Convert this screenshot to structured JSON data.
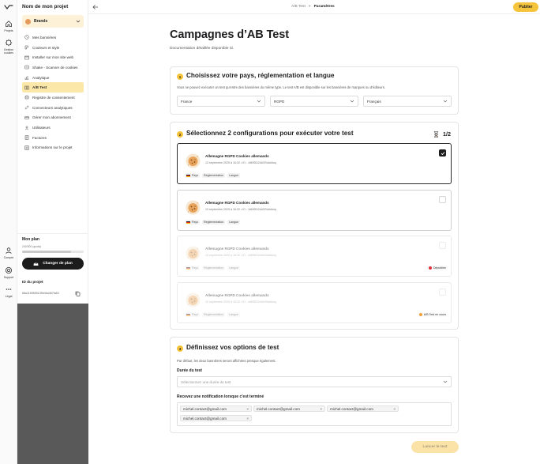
{
  "rail": {
    "items": [
      {
        "label": "Projets"
      },
      {
        "label": "Gestion cookies"
      },
      {
        "label": "Compte"
      },
      {
        "label": "Support"
      },
      {
        "label": "Légal"
      }
    ]
  },
  "sidebar": {
    "project_name": "Nom de mon projet",
    "brand_select": "Brands",
    "items": [
      {
        "label": "Mes bannières",
        "icon": "banner-icon"
      },
      {
        "label": "Couleurs et style",
        "icon": "palette-icon"
      },
      {
        "label": "Installer sur mon site web",
        "icon": "code-icon"
      },
      {
        "label": "Shake - Scanner de cookies",
        "icon": "scanner-icon"
      },
      {
        "label": "Analytique",
        "icon": "analytics-icon"
      },
      {
        "label": "A/B Test",
        "icon": "ab-test-icon",
        "active": true
      },
      {
        "label": "Registre de consentement",
        "icon": "registry-icon"
      },
      {
        "label": "Connecteurs analytiques",
        "icon": "link-icon"
      },
      {
        "label": "Gérer mon abonnement",
        "icon": "subscription-icon"
      },
      {
        "label": "Utilisateurs",
        "icon": "users-icon"
      },
      {
        "label": "Factures",
        "icon": "invoice-icon"
      },
      {
        "label": "Informations sur le projet",
        "icon": "info-icon"
      }
    ],
    "plan": {
      "title": "Mon plan",
      "quota": "240/300 (quota)",
      "quota_fraction": 0.8,
      "button": "Changer de plan"
    },
    "project_id": {
      "title": "ID du projet",
      "value": "66a1159655135b4ba467fa63"
    }
  },
  "topbar": {
    "breadcrumb_parent": "A/B Test",
    "breadcrumb_separator": ">",
    "breadcrumb_current": "Paramètres",
    "publish": "Publier"
  },
  "main": {
    "title": "Campagnes d’AB Test",
    "subtitle": "Documentation détaillée disponible ici.",
    "step1": {
      "number": "1",
      "title": "Choisissez votre pays, réglementation et langue",
      "desc": "Vous ne pouvez exécuter un test qu'entre des bannières du même type. Le test A/B est disponible sur les bannières de marques ou d'éditeurs.",
      "country": "France",
      "regulation": "RGPD",
      "language": "Français"
    },
    "step2": {
      "number": "2",
      "title": "Sélectionnez 2 configurations pour exécuter votre test",
      "counter": "1/2",
      "configs": [
        {
          "name": "Allemagne RGPD Cookies allemands",
          "date": "13 septembre 2025 à 16:32",
          "bullet": "•",
          "id": "ID : Jd69DD2dU5Sdddduq",
          "tags": [
            "Pays",
            "Réglementation",
            "Langue"
          ],
          "checked": true,
          "status": ""
        },
        {
          "name": "Allemagne RGPD Cookies allemands",
          "date": "13 septembre 2025 à 16:32",
          "bullet": "•",
          "id": "ID : Jd69DD2dU5Sdddduq",
          "tags": [
            "Pays",
            "Réglementation",
            "Langue"
          ],
          "checked": false,
          "status": ""
        },
        {
          "name": "Allemagne RGPD Cookies allemands",
          "date": "13 septembre 2025 à 16:32",
          "bullet": "•",
          "id": "ID : Jd69DD2dU5Sdddduq",
          "tags": [
            "Pays",
            "Réglementation",
            "Langue"
          ],
          "checked": false,
          "status": "Dépubliée",
          "status_color": "#e0323a"
        },
        {
          "name": "Allemagne RGPD Cookies allemands",
          "date": "13 septembre 2025 à 16:32",
          "bullet": "•",
          "id": "ID : Jd69DD2dU5Sdddduq",
          "tags": [
            "Pays",
            "Réglementation",
            "Langue"
          ],
          "checked": false,
          "status": "A/B Test en cours",
          "status_color": "#f0a23a"
        }
      ]
    },
    "step3": {
      "number": "3",
      "title": "Définissez vos options de test",
      "desc": "Par défaut, les deux bannières seront affichées presque également.",
      "duration_label": "Durée du test",
      "duration_placeholder": "Sélectionnez une durée de test",
      "notify_label": "Recevez une notification lorsque c'est terminé",
      "emails": [
        "michel.contact@gmail.com",
        "michel.contact@gmail.com",
        "michel.contact@gmail.com",
        "michel.contact@gmail.com"
      ],
      "chip_remove": "×"
    },
    "launch": "Lancer le test"
  },
  "colors": {
    "accent": "#f6c43b",
    "active_bg": "#fbe7a8",
    "dark": "#1d1d1f"
  }
}
